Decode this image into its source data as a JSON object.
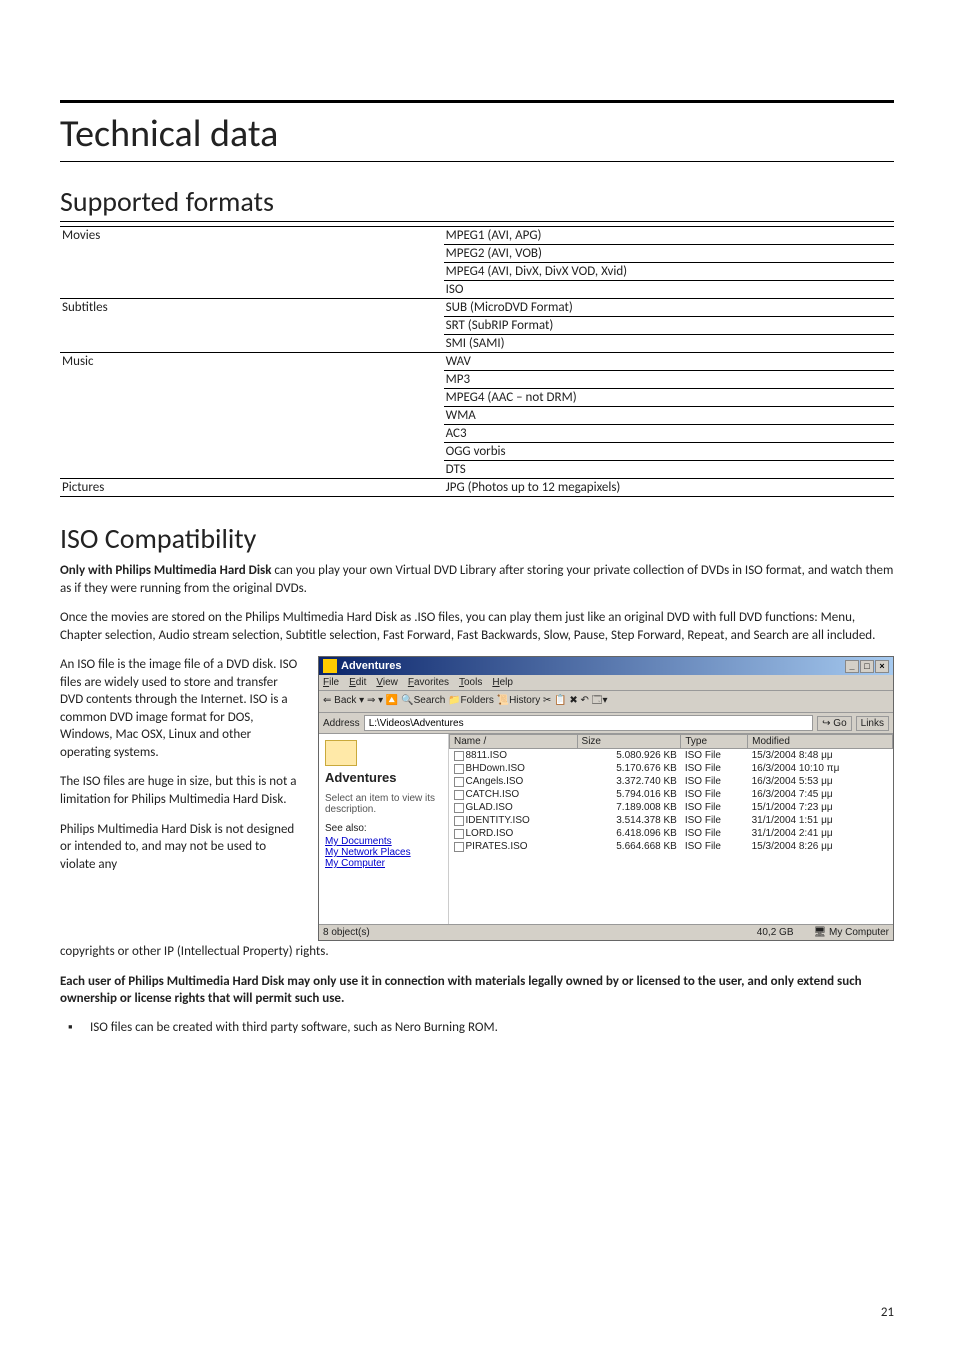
{
  "page_number": "21",
  "headings": {
    "h1": "Technical data",
    "h2a": "Supported formats",
    "h2b": "ISO Compatibility"
  },
  "formats": {
    "rows": [
      {
        "cat": "Movies",
        "val": "MPEG1 (AVI, APG)",
        "first": true
      },
      {
        "cat": "",
        "val": "MPEG2 (AVI, VOB)"
      },
      {
        "cat": "",
        "val": "MPEG4 (AVI, DivX, DivX VOD, Xvid)"
      },
      {
        "cat": "",
        "val": "ISO"
      },
      {
        "cat": "Subtitles",
        "val": "SUB (MicroDVD Format)",
        "first": true
      },
      {
        "cat": "",
        "val": "SRT (SubRIP Format)"
      },
      {
        "cat": "",
        "val": "SMI (SAMI)"
      },
      {
        "cat": "Music",
        "val": "WAV",
        "first": true
      },
      {
        "cat": "",
        "val": "MP3"
      },
      {
        "cat": "",
        "val": "MPEG4 (AAC – not DRM)"
      },
      {
        "cat": "",
        "val": "WMA"
      },
      {
        "cat": "",
        "val": "AC3"
      },
      {
        "cat": "",
        "val": "OGG vorbis"
      },
      {
        "cat": "",
        "val": "DTS"
      },
      {
        "cat": "Pictures",
        "val": "JPG (Photos up to 12 megapixels)",
        "first": true,
        "last": true
      }
    ]
  },
  "iso_para1_bold": "Only with Philips Multimedia Hard Disk",
  "iso_para1_rest": " can you play your own Virtual DVD Library after storing your private collection of DVDs in ISO format, and watch them as if they were running from the original DVDs.",
  "iso_para2": "Once the movies are stored on the Philips Multimedia Hard Disk as .ISO files, you can play them just like an original DVD with full DVD functions: Menu, Chapter selection, Audio stream selection, Subtitle selection, Fast Forward, Fast Backwards, Slow, Pause, Step Forward, Repeat, and Search are all included.",
  "iso_left_p1": "An ISO file is the image file of a DVD disk. ISO files are widely used to store and transfer DVD contents through the Internet. ISO is a common DVD image format for DOS, Windows, Mac OSX, Linux and other operating systems.",
  "iso_left_p2": "The ISO files are huge in size, but this is not a limitation for Philips Multimedia Hard Disk.",
  "iso_left_p3": "Philips Multimedia Hard Disk is not designed or intended to, and may not be used to violate any",
  "iso_after_fig": "copyrights or other IP (Intellectual Property) rights.",
  "iso_bold_para": "Each user of Philips Multimedia Hard Disk may only use it in connection with materials legally owned by or licensed to the user, and only extend such ownership or license rights that will permit such use.",
  "iso_bullet": "ISO files can be created with third party software, such as Nero Burning ROM.",
  "explorer": {
    "title": "Adventures",
    "menu": [
      "File",
      "Edit",
      "View",
      "Favorites",
      "Tools",
      "Help"
    ],
    "toolbar": "⇐ Back  ▾  ⇒  ▾  🔼   🔍Search  📁Folders  📜History   ✂ 📋 ✖ ↶   🗔▾",
    "address_label": "Address",
    "address_value": "L:\\Videos\\Adventures",
    "go": "Go",
    "links": "Links",
    "side": {
      "folder": "Adventures",
      "desc": "Select an item to view its description.",
      "seealso": "See also:",
      "links": [
        "My Documents",
        "My Network Places",
        "My Computer"
      ]
    },
    "cols": [
      "Name  /",
      "Size",
      "Type",
      "Modified"
    ],
    "files": [
      {
        "n": "8811.ISO",
        "s": "5.080.926 KB",
        "t": "ISO File",
        "m": "15/3/2004 8:48 μμ"
      },
      {
        "n": "BHDown.ISO",
        "s": "5.170.676 KB",
        "t": "ISO File",
        "m": "16/3/2004 10:10 πμ"
      },
      {
        "n": "CAngels.ISO",
        "s": "3.372.740 KB",
        "t": "ISO File",
        "m": "16/3/2004 5:53 μμ"
      },
      {
        "n": "CATCH.ISO",
        "s": "5.794.016 KB",
        "t": "ISO File",
        "m": "16/3/2004 7:45 μμ"
      },
      {
        "n": "GLAD.ISO",
        "s": "7.189.008 KB",
        "t": "ISO File",
        "m": "15/1/2004 7:23 μμ"
      },
      {
        "n": "IDENTITY.ISO",
        "s": "3.514.378 KB",
        "t": "ISO File",
        "m": "31/1/2004 1:51 μμ"
      },
      {
        "n": "LORD.ISO",
        "s": "6.418.096 KB",
        "t": "ISO File",
        "m": "31/1/2004 2:41 μμ"
      },
      {
        "n": "PIRATES.ISO",
        "s": "5.664.668 KB",
        "t": "ISO File",
        "m": "15/3/2004 8:26 μμ"
      }
    ],
    "status": {
      "objects": "8 object(s)",
      "size": "40,2 GB",
      "loc": "My Computer"
    }
  }
}
